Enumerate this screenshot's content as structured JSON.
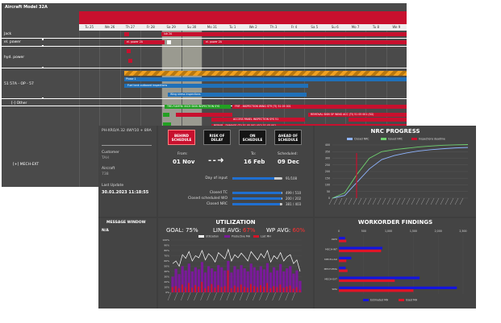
{
  "gantt": {
    "title": "Aircraft Model 32A",
    "dates": [
      "Tu 25",
      "We 26",
      "Th 27",
      "Fr 28",
      "Sa 29",
      "Su 30",
      "Mo 31",
      "Tu 1",
      "We 2",
      "Th 3",
      "Fr 4",
      "Sa 5",
      "Su 6",
      "Mo 7",
      "Tu 8",
      "We 9"
    ],
    "rows": [
      "Jack",
      "el. power",
      "hyd. power",
      "51 57A - OP - 57",
      "[-] Other",
      "[+] MECH-EXT"
    ],
    "bars": {
      "b1": "lub 2A",
      "b2": "el. power 2A",
      "b3": "el. power 2A",
      "b4": "Phase 1",
      "b5": "Fuel tank outboard inspections",
      "b6": "Wing stress inspections",
      "b7": "TRE-FIXMYN: INCH SKIN INSPECTION SYS",
      "b8": "FMF - INSPECTION WING STR (TI) 51 05 001",
      "b9": "REMOVAL SKIN OF WING ACC (TI) 51 05 001 (SG)",
      "b10": "ACCESS PANEL INSPECTION SYS 51",
      "b11": "REPAIR - DAMAGE (TI) 51 05 001 (SG) 51 05 001"
    }
  },
  "dashboard": {
    "aircraft_line": "PH-XRO/A 32 4WY10 + 89A",
    "customer_label": "Customer",
    "customer_value": "TAH",
    "aircraft_label": "Aircraft",
    "aircraft_value": "738",
    "last_update_label": "Last Update",
    "last_update_value": "30.01.2023 11:18:55",
    "buttons": {
      "behind": "BEHIND SCHEDULE",
      "risk": "RISK OF DELAY",
      "on": "ON SCHEDULE",
      "ahead": "AHEAD OF SCHEDULE"
    },
    "from_label": "From:",
    "from_value": "01 Nov",
    "to_label": "To:",
    "to_value": "16 Feb",
    "scheduled_label": "Scheduled:",
    "scheduled_value": "09 Dec",
    "progress": [
      {
        "label": "Day of input",
        "value": "91/108",
        "fraction": 0.84
      },
      {
        "label": "Closed TC",
        "value": "499 / 510",
        "fraction": 0.98
      },
      {
        "label": "Closed scheduled WO",
        "value": "200 / 202",
        "fraction": 0.99
      },
      {
        "label": "Closed NRC",
        "value": "381 / 403",
        "fraction": 0.95
      }
    ],
    "message_window_label": "MESSAGE WINDOW",
    "message_value": "N/A",
    "utilization": {
      "title": "UTILIZATION",
      "goal": "GOAL: 75%",
      "line_avg_label": "LINE AVG:",
      "line_avg_value": "67%",
      "wp_avg_label": "WP AVG:",
      "wp_avg_value": "60%",
      "legend": [
        "Utilization",
        "Productive MH",
        "Lost MH"
      ]
    },
    "nrc": {
      "title": "NRC PROGRESS",
      "legend": [
        "Closed NRC",
        "Issued NRC",
        "Inspections deadline"
      ]
    },
    "findings": {
      "title": "WORKORDER FINDINGS",
      "legend": [
        "Estimated MH",
        "Used MH"
      ]
    }
  },
  "colors": {
    "accent_red": "#c8102e",
    "blue": "#1f6fd1",
    "green": "#6fd16f",
    "light_blue": "#8fb4ff"
  },
  "chart_data": [
    {
      "type": "line",
      "title": "NRC PROGRESS",
      "ylim": [
        0,
        400
      ],
      "yticks": [
        0,
        50,
        100,
        150,
        200,
        250,
        300,
        350,
        400
      ],
      "series": [
        {
          "name": "Closed NRC",
          "values": [
            0,
            20,
            120,
            220,
            290,
            320,
            340,
            355,
            365,
            372,
            378,
            381
          ]
        },
        {
          "name": "Issued NRC",
          "values": [
            0,
            40,
            180,
            300,
            350,
            365,
            375,
            385,
            392,
            398,
            401,
            403
          ]
        }
      ]
    },
    {
      "type": "bar",
      "title": "UTILIZATION",
      "ylim": [
        0,
        100
      ],
      "yticks": [
        "0%",
        "10%",
        "20%",
        "30%",
        "40%",
        "50%",
        "60%",
        "70%",
        "80%",
        "90%",
        "100%"
      ],
      "series": [
        {
          "name": "Utilization",
          "values": [
            55,
            60,
            50,
            72,
            65,
            78,
            60,
            70,
            66,
            80,
            62,
            74,
            68,
            58,
            76,
            70,
            64,
            82,
            60,
            72,
            66,
            75,
            68,
            60,
            78,
            70,
            62,
            74,
            66,
            80,
            58,
            70,
            64,
            76,
            60,
            68,
            72,
            55,
            62,
            40
          ]
        },
        {
          "name": "Productive MH",
          "values": [
            30,
            45,
            35,
            50,
            42,
            55,
            40,
            48,
            44,
            58,
            38,
            50,
            46,
            40,
            52,
            48,
            42,
            60,
            38,
            50,
            44,
            52,
            46,
            40,
            55,
            48,
            42,
            50,
            44,
            56,
            38,
            48,
            42,
            54,
            40,
            46,
            50,
            36,
            42,
            22
          ]
        },
        {
          "name": "Lost MH",
          "values": [
            10,
            12,
            8,
            15,
            10,
            18,
            9,
            14,
            11,
            20,
            8,
            12,
            16,
            9,
            14,
            10,
            12,
            42,
            8,
            13,
            10,
            15,
            11,
            9,
            16,
            12,
            10,
            14,
            11,
            18,
            8,
            12,
            10,
            15,
            9,
            11,
            13,
            7,
            10,
            5
          ]
        }
      ]
    },
    {
      "type": "bar",
      "title": "WORKORDER FINDINGS",
      "categories": [
        "AWO",
        "MECH-INT",
        "MECH-LSO",
        "MECH-ENG",
        "MECH-EXT",
        "SMA"
      ],
      "xlim": [
        0,
        2000
      ],
      "xticks": [
        "0",
        "500",
        "1,000",
        "1,500",
        "2,000",
        "2,500"
      ],
      "series": [
        {
          "name": "Estimated MH",
          "values": [
            100,
            700,
            200,
            110,
            1300,
            1900
          ]
        },
        {
          "name": "Used MH",
          "values": [
            120,
            680,
            120,
            140,
            900,
            1200
          ]
        }
      ]
    }
  ]
}
